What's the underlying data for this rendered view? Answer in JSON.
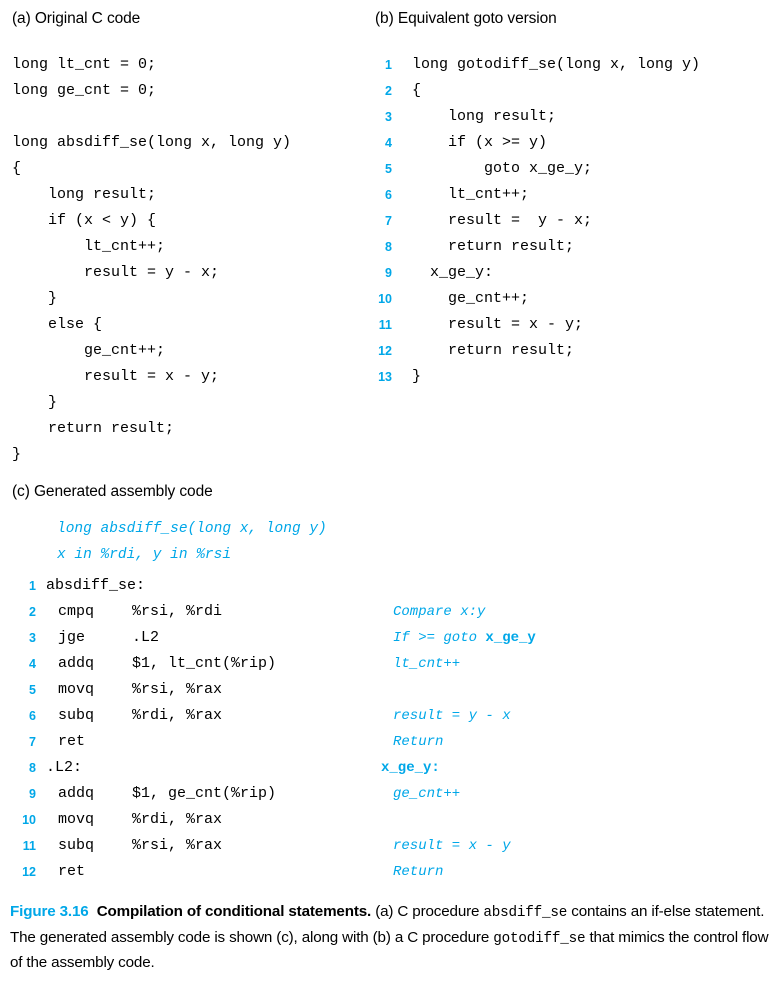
{
  "colors": {
    "accent_blue": "#00a7e8",
    "text": "#000000",
    "background": "#ffffff"
  },
  "panel_a": {
    "heading": "(a) Original C code",
    "code_lines": [
      "long lt_cnt = 0;",
      "long ge_cnt = 0;",
      "",
      "long absdiff_se(long x, long y)",
      "{",
      "    long result;",
      "    if (x < y) {",
      "        lt_cnt++;",
      "        result = y - x;",
      "    }",
      "    else {",
      "        ge_cnt++;",
      "        result = x - y;",
      "    }",
      "    return result;",
      "}"
    ]
  },
  "panel_b": {
    "heading": "(b) Equivalent goto version",
    "line_numbers": [
      "1",
      "2",
      "3",
      "4",
      "5",
      "6",
      "7",
      "8",
      "9",
      "10",
      "11",
      "12",
      "13"
    ],
    "code_lines": [
      "long gotodiff_se(long x, long y)",
      "{",
      "    long result;",
      "    if (x >= y)",
      "        goto x_ge_y;",
      "    lt_cnt++;",
      "    result =  y - x;",
      "    return result;",
      "  x_ge_y:",
      "    ge_cnt++;",
      "    result = x - y;",
      "    return result;",
      "}"
    ]
  },
  "panel_c": {
    "heading": "(c) Generated assembly code",
    "signature": "long absdiff_se(long x, long y)",
    "registers": "x in %rdi, y in %rsi",
    "rows": [
      {
        "num": "1",
        "mnemonic": "absdiff_se:",
        "operands": "",
        "comment": "",
        "comment_kind": "none"
      },
      {
        "num": "2",
        "mnemonic": "cmpq",
        "operands": "%rsi, %rdi",
        "comment": "Compare x:y",
        "comment_kind": "italic"
      },
      {
        "num": "3",
        "mnemonic": "jge",
        "operands": ".L2",
        "comment": "If >= goto ",
        "comment_bold": "x_ge_y",
        "comment_kind": "italic-bold"
      },
      {
        "num": "4",
        "mnemonic": "addq",
        "operands": "$1, lt_cnt(%rip)",
        "comment": "lt_cnt++",
        "comment_kind": "italic"
      },
      {
        "num": "5",
        "mnemonic": "movq",
        "operands": "%rsi, %rax",
        "comment": "",
        "comment_kind": "none"
      },
      {
        "num": "6",
        "mnemonic": "subq",
        "operands": "%rdi, %rax",
        "comment": "result = y - x",
        "comment_kind": "italic"
      },
      {
        "num": "7",
        "mnemonic": "ret",
        "operands": "",
        "comment": "Return",
        "comment_kind": "italic"
      },
      {
        "num": "8",
        "mnemonic": ".L2:",
        "operands": "",
        "comment": "x_ge_y:",
        "comment_kind": "bold-label"
      },
      {
        "num": "9",
        "mnemonic": "addq",
        "operands": "$1, ge_cnt(%rip)",
        "comment": "ge_cnt++",
        "comment_kind": "italic"
      },
      {
        "num": "10",
        "mnemonic": "movq",
        "operands": "%rdi, %rax",
        "comment": "",
        "comment_kind": "none"
      },
      {
        "num": "11",
        "mnemonic": "subq",
        "operands": "%rsi, %rax",
        "comment": "result = x - y",
        "comment_kind": "italic"
      },
      {
        "num": "12",
        "mnemonic": "ret",
        "operands": "",
        "comment": "Return",
        "comment_kind": "italic"
      }
    ]
  },
  "caption": {
    "figure_number": "Figure 3.16",
    "title": "Compilation of conditional statements.",
    "body_1": " (a) C procedure ",
    "mono_1": "absdiff_se",
    "body_2": " contains an if-else statement. The generated assembly code is shown (c), along with (b) a C procedure ",
    "mono_2": "gotodiff_se",
    "body_3": " that mimics the control flow of the assembly code."
  }
}
